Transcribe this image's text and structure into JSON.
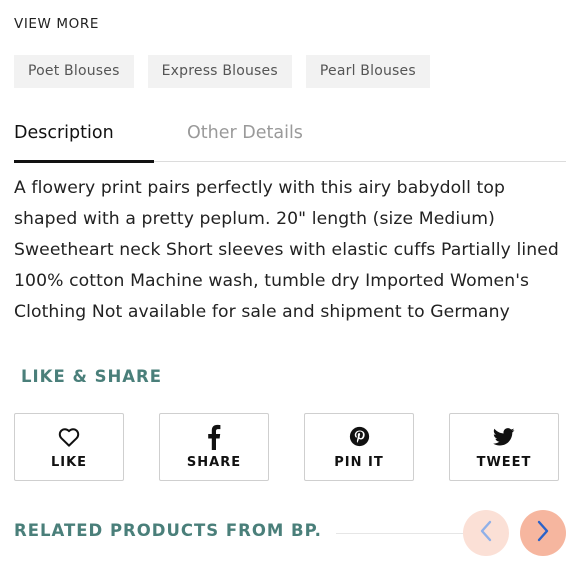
{
  "view_more": {
    "title": "VIEW MORE",
    "tags": [
      "Poet Blouses",
      "Express Blouses",
      "Pearl Blouses"
    ]
  },
  "tabs": {
    "description": "Description",
    "other_details": "Other Details"
  },
  "description": "A flowery print pairs perfectly with this airy babydoll top shaped with a pretty peplum. 20\" length (size Medium) Sweetheart neck Short sleeves with elastic cuffs Partially lined 100% cotton Machine wash, tumble dry Imported Women's Clothing Not available for sale and shipment to Germany",
  "like_share": {
    "title": "LIKE & SHARE",
    "buttons": [
      {
        "label": "LIKE",
        "icon": "heart-icon"
      },
      {
        "label": "SHARE",
        "icon": "facebook-icon"
      },
      {
        "label": "PIN IT",
        "icon": "pinterest-icon"
      },
      {
        "label": "TWEET",
        "icon": "twitter-icon"
      }
    ]
  },
  "related": {
    "title": "RELATED PRODUCTS FROM BP."
  },
  "colors": {
    "accent_teal": "#4a7f7a",
    "nav_prev_bg": "#fbe0d6",
    "nav_next_bg": "#f6b69f",
    "nav_prev_arrow": "#8fb0e8",
    "nav_next_arrow": "#2a62c9"
  }
}
